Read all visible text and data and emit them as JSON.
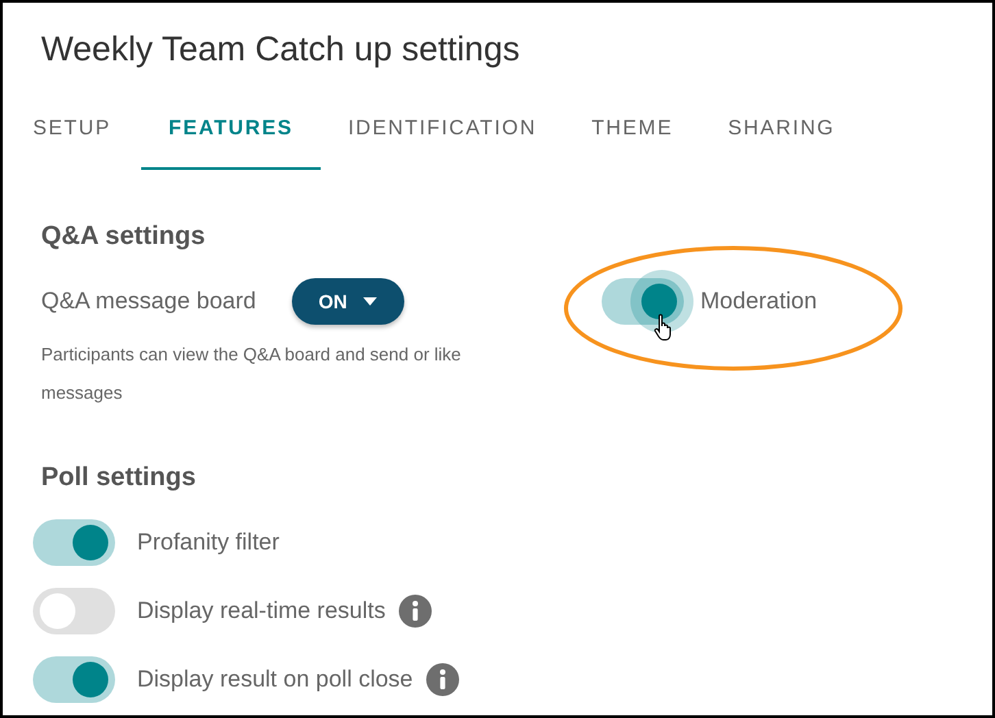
{
  "window": {
    "title": "Weekly Team Catch up settings"
  },
  "tabs": [
    {
      "label": "SETUP",
      "selected": false
    },
    {
      "label": "FEATURES",
      "selected": true
    },
    {
      "label": "IDENTIFICATION",
      "selected": false
    },
    {
      "label": "THEME",
      "selected": false
    },
    {
      "label": "SHARING",
      "selected": false
    }
  ],
  "qa": {
    "heading": "Q&A settings",
    "message_board": {
      "label": "Q&A message board",
      "value": "ON"
    },
    "description": "Participants can view the Q&A board and send or like messages",
    "moderation": {
      "label": "Moderation",
      "on": true,
      "hovered": true
    }
  },
  "poll": {
    "heading": "Poll settings",
    "options": [
      {
        "label": "Profanity filter",
        "on": true,
        "info": false
      },
      {
        "label": "Display real-time results",
        "on": false,
        "info": true
      },
      {
        "label": "Display result on poll close",
        "on": true,
        "info": true
      }
    ]
  }
}
